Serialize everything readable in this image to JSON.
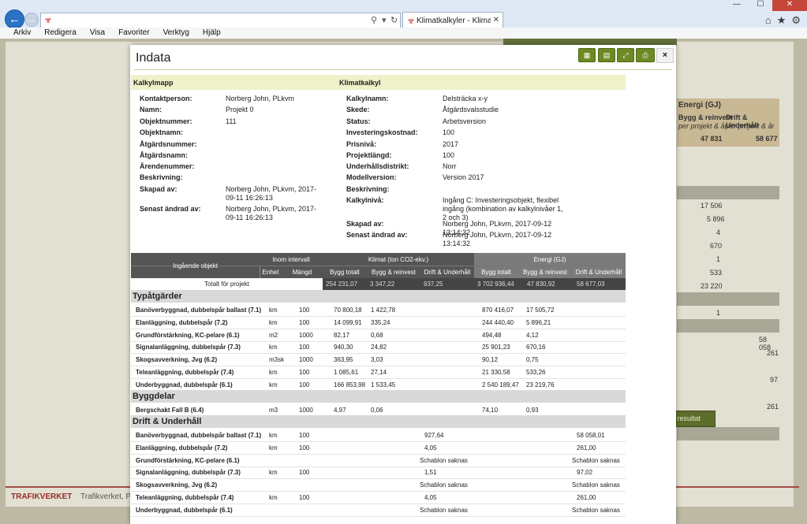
{
  "browser": {
    "tab_title": "Klimatkalkyler - Klimatkalkyl",
    "menu": [
      "Arkiv",
      "Redigera",
      "Visa",
      "Favoriter",
      "Verktyg",
      "Hjälp"
    ],
    "addr_icons": [
      "search-icon",
      "dropdown-icon",
      "refresh-icon"
    ],
    "win_controls": [
      "—",
      "☐",
      "✕"
    ]
  },
  "background": {
    "energy_header": "Energi (GJ)",
    "col1_title": "Bygg & reinvest",
    "col1_sub": "per projekt & år",
    "col2_title": "Drift & Underhåll",
    "col2_sub": "per projekt & år",
    "val1": "47 831",
    "val2": "58 677",
    "rows": [
      "17 506",
      "5 896",
      "4",
      "670",
      "1",
      "533",
      "23 220",
      "1",
      "58 058",
      "261",
      "97",
      "261"
    ],
    "button": "ng resultat",
    "footer_logo": "TRAFIKVERKET",
    "footer_text": "Trafikverket, Post"
  },
  "modal": {
    "title": "Indata",
    "close": "×",
    "info": {
      "left_header": "Kalkylmapp",
      "right_header": "Klimatkalkyl",
      "left": [
        {
          "label": "Kontaktperson:",
          "value": "Norberg John, PLkvm"
        },
        {
          "label": "Namn:",
          "value": "Projekt 0"
        },
        {
          "label": "Objektnummer:",
          "value": "111"
        },
        {
          "label": "Objektnamn:",
          "value": ""
        },
        {
          "label": "Åtgärdsnummer:",
          "value": ""
        },
        {
          "label": "Åtgärdsnamn:",
          "value": ""
        },
        {
          "label": "Ärendenummer:",
          "value": ""
        },
        {
          "label": "Beskrivning:",
          "value": ""
        },
        {
          "label": "Skapad av:",
          "value": "Norberg John, PLkvm, 2017-09-11 16:26:13"
        },
        {
          "label": "Senast ändrad av:",
          "value": "Norberg John, PLkvm, 2017-09-11 16:26:13"
        }
      ],
      "right": [
        {
          "label": "Kalkylnamn:",
          "value": "Delsträcka x-y"
        },
        {
          "label": "Skede:",
          "value": "Åtgärdsvalsstudie"
        },
        {
          "label": "Status:",
          "value": "Arbetsversion"
        },
        {
          "label": "Investeringskostnad:",
          "value": "100"
        },
        {
          "label": "Prisnivå:",
          "value": "2017"
        },
        {
          "label": "Projektlängd:",
          "value": "100"
        },
        {
          "label": "Underhållsdistrikt:",
          "value": "Norr"
        },
        {
          "label": "Modellversion:",
          "value": "Version 2017"
        },
        {
          "label": "Beskrivning:",
          "value": ""
        },
        {
          "label": "Kalkylnivå:",
          "value": "Ingång C: Investeringsobjekt, flexibel ingång (kombination av kalkylnivåer 1, 2 och 3)"
        },
        {
          "label": "Skapad av:",
          "value": "Norberg John, PLkvm, 2017-09-12 13:14:32"
        },
        {
          "label": "Senast ändrad av:",
          "value": "Norberg John, PLkvm, 2017-09-12 13:14:32"
        }
      ]
    },
    "table": {
      "h_object": "Ingående objekt",
      "h_interval": "Inom intervall",
      "h_unit": "Enhet",
      "h_qty": "Mängd",
      "h_klimat": "Klimat (ton CO2-ekv.)",
      "h_energi": "Energi (GJ)",
      "h_bygg": "Bygg totalt",
      "h_reinvest": "Bygg & reinvest",
      "h_drift": "Drift & Underhåll",
      "total_label": "Totalt för projekt",
      "totals": [
        "254 231,07",
        "3 347,22",
        "937,25",
        "3 702 936,44",
        "47 830,92",
        "58 677,03"
      ],
      "sections": [
        {
          "title": "Typåtgärder",
          "rows": [
            {
              "name": "Banöverbyggnad, dubbelspår ballast (7.1)",
              "unit": "km",
              "qty": "100",
              "k1": "70 800,18",
              "k2": "1 422,78",
              "k3": "",
              "e1": "870 416,07",
              "e2": "17 505,72",
              "e3": ""
            },
            {
              "name": "Elanläggning, dubbelspår (7.2)",
              "unit": "km",
              "qty": "100",
              "k1": "14 099,91",
              "k2": "335,24",
              "k3": "",
              "e1": "244 440,40",
              "e2": "5 896,21",
              "e3": ""
            },
            {
              "name": "Grundförstärkning, KC-pelare (6.1)",
              "unit": "m2",
              "qty": "1000",
              "k1": "82,17",
              "k2": "0,68",
              "k3": "",
              "e1": "494,48",
              "e2": "4,12",
              "e3": ""
            },
            {
              "name": "Signalanläggning, dubbelspår (7.3)",
              "unit": "km",
              "qty": "100",
              "k1": "940,30",
              "k2": "24,82",
              "k3": "",
              "e1": "25 901,23",
              "e2": "670,16",
              "e3": ""
            },
            {
              "name": "Skogsavverkning, Jvg (6.2)",
              "unit": "m3sk",
              "qty": "1000",
              "k1": "363,95",
              "k2": "3,03",
              "k3": "",
              "e1": "90,12",
              "e2": "0,75",
              "e3": ""
            },
            {
              "name": "Teleanläggning, dubbelspår (7.4)",
              "unit": "km",
              "qty": "100",
              "k1": "1 085,61",
              "k2": "27,14",
              "k3": "",
              "e1": "21 330,58",
              "e2": "533,26",
              "e3": ""
            },
            {
              "name": "Underbyggnad, dubbelspår (6.1)",
              "unit": "km",
              "qty": "100",
              "k1": "166 853,98",
              "k2": "1 533,45",
              "k3": "",
              "e1": "2 540 189,47",
              "e2": "23 219,76",
              "e3": ""
            }
          ]
        },
        {
          "title": "Byggdelar",
          "rows": [
            {
              "name": "Bergschakt Fall B (6.4)",
              "unit": "m3",
              "qty": "1000",
              "k1": "4,97",
              "k2": "0,06",
              "k3": "",
              "e1": "74,10",
              "e2": "0,93",
              "e3": ""
            }
          ]
        },
        {
          "title": "Drift & Underhåll",
          "rows": [
            {
              "name": "Banöverbyggnad, dubbelspår ballast (7.1)",
              "unit": "km",
              "qty": "100",
              "k1": "",
              "k2": "",
              "k3": "927,64",
              "e1": "",
              "e2": "",
              "e3": "58 058,01"
            },
            {
              "name": "Elanläggning, dubbelspår (7.2)",
              "unit": "km",
              "qty": "100",
              "k1": "",
              "k2": "",
              "k3": "4,05",
              "e1": "",
              "e2": "",
              "e3": "261,00"
            },
            {
              "name": "Grundförstärkning, KC-pelare (6.1)",
              "unit": "",
              "qty": "",
              "k1": "",
              "k2": "",
              "k3": "Schablon saknas",
              "e1": "",
              "e2": "",
              "e3": "Schablon saknas"
            },
            {
              "name": "Signalanläggning, dubbelspår (7.3)",
              "unit": "km",
              "qty": "100",
              "k1": "",
              "k2": "",
              "k3": "1,51",
              "e1": "",
              "e2": "",
              "e3": "97,02"
            },
            {
              "name": "Skogsavverkning, Jvg (6.2)",
              "unit": "",
              "qty": "",
              "k1": "",
              "k2": "",
              "k3": "Schablon saknas",
              "e1": "",
              "e2": "",
              "e3": "Schablon saknas"
            },
            {
              "name": "Teleanläggning, dubbelspår (7.4)",
              "unit": "km",
              "qty": "100",
              "k1": "",
              "k2": "",
              "k3": "4,05",
              "e1": "",
              "e2": "",
              "e3": "261,00"
            },
            {
              "name": "Underbyggnad, dubbelspår (6.1)",
              "unit": "",
              "qty": "",
              "k1": "",
              "k2": "",
              "k3": "Schablon saknas",
              "e1": "",
              "e2": "",
              "e3": "Schablon saknas"
            }
          ]
        }
      ]
    }
  }
}
